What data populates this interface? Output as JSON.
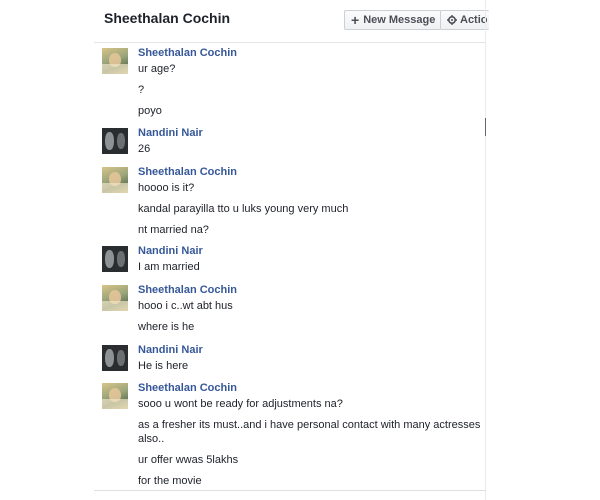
{
  "header": {
    "title": "Sheethalan Cochin",
    "new_message_label": "New Message",
    "actions_label": "Actio"
  },
  "thread": [
    {
      "sender": "Sheethalan Cochin",
      "avatar": "sheethalan",
      "messages": [
        "ur age?",
        "?",
        "poyo"
      ]
    },
    {
      "sender": "Nandini Nair",
      "avatar": "nandini",
      "messages": [
        "26"
      ]
    },
    {
      "sender": "Sheethalan Cochin",
      "avatar": "sheethalan",
      "messages": [
        "hoooo is it?",
        "kandal parayilla tto u luks young very much",
        "nt married na?"
      ]
    },
    {
      "sender": "Nandini Nair",
      "avatar": "nandini",
      "messages": [
        "I am married"
      ]
    },
    {
      "sender": "Sheethalan Cochin",
      "avatar": "sheethalan",
      "messages": [
        "hooo i c..wt abt hus",
        "where is he"
      ]
    },
    {
      "sender": "Nandini Nair",
      "avatar": "nandini",
      "messages": [
        "He is here"
      ]
    },
    {
      "sender": "Sheethalan Cochin",
      "avatar": "sheethalan",
      "messages": [
        "sooo u wont be ready for adjustments na?",
        "as a fresher its must..and i have personal contact with many actresses also..",
        "ur offer wwas 5lakhs",
        "for the movie"
      ]
    }
  ]
}
